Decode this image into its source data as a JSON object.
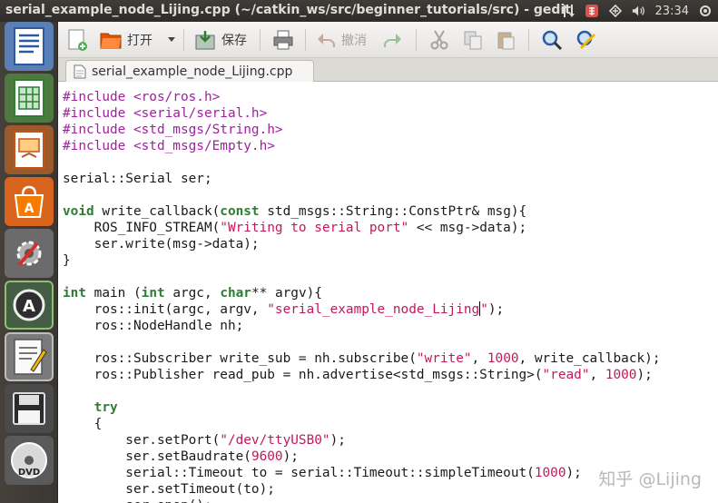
{
  "window_title": "serial_example_node_Lijing.cpp (~/catkin_ws/src/beginner_tutorials/src) - gedit",
  "tray": {
    "clock": "23:34",
    "icons": [
      "sort-arrows-icon",
      "keyboard-input-icon",
      "network-icon",
      "volume-icon"
    ]
  },
  "launcher": {
    "items": [
      "writer-icon",
      "calc-icon",
      "impress-icon",
      "software-center-icon",
      "system-settings-icon",
      "update-manager-icon",
      "text-editor-icon",
      "floppy-save-icon",
      "dvd-icon"
    ]
  },
  "toolbar": {
    "open_label": "打开",
    "save_label": "保存",
    "undo_label": "撤消"
  },
  "tab": {
    "label": "serial_example_node_Lijing.cpp"
  },
  "code_lines": [
    [
      {
        "t": "#include <ros/ros.h>",
        "c": "pp"
      }
    ],
    [
      {
        "t": "#include <serial/serial.h>",
        "c": "pp"
      }
    ],
    [
      {
        "t": "#include <std_msgs/String.h>",
        "c": "pp"
      }
    ],
    [
      {
        "t": "#include <std_msgs/Empty.h>",
        "c": "pp"
      }
    ],
    [],
    [
      {
        "t": "serial::Serial ser;"
      }
    ],
    [],
    [
      {
        "t": "void",
        "c": "kw"
      },
      {
        "t": " write_callback("
      },
      {
        "t": "const",
        "c": "kw"
      },
      {
        "t": " std_msgs::String::ConstPtr& msg){"
      }
    ],
    [
      {
        "t": "    ROS_INFO_STREAM("
      },
      {
        "t": "\"Writing to serial port\"",
        "c": "st"
      },
      {
        "t": " << msg->data);"
      }
    ],
    [
      {
        "t": "    ser.write(msg->data);"
      }
    ],
    [
      {
        "t": "}"
      }
    ],
    [],
    [
      {
        "t": "int",
        "c": "kw"
      },
      {
        "t": " main ("
      },
      {
        "t": "int",
        "c": "kw"
      },
      {
        "t": " argc, "
      },
      {
        "t": "char",
        "c": "kw"
      },
      {
        "t": "** argv){"
      }
    ],
    [
      {
        "t": "    ros::init(argc, argv, "
      },
      {
        "t": "\"serial_example_node_Lijing",
        "c": "st"
      },
      {
        "t": "",
        "c": "caret"
      },
      {
        "t": "\"",
        "c": "st"
      },
      {
        "t": ");"
      }
    ],
    [
      {
        "t": "    ros::NodeHandle nh;"
      }
    ],
    [],
    [
      {
        "t": "    ros::Subscriber write_sub = nh.subscribe("
      },
      {
        "t": "\"write\"",
        "c": "st"
      },
      {
        "t": ", "
      },
      {
        "t": "1000",
        "c": "nm"
      },
      {
        "t": ", write_callback);"
      }
    ],
    [
      {
        "t": "    ros::Publisher read_pub = nh.advertise<std_msgs::String>("
      },
      {
        "t": "\"read\"",
        "c": "st"
      },
      {
        "t": ", "
      },
      {
        "t": "1000",
        "c": "nm"
      },
      {
        "t": ");"
      }
    ],
    [],
    [
      {
        "t": "    "
      },
      {
        "t": "try",
        "c": "kw"
      }
    ],
    [
      {
        "t": "    {"
      }
    ],
    [
      {
        "t": "        ser.setPort("
      },
      {
        "t": "\"/dev/ttyUSB0\"",
        "c": "st"
      },
      {
        "t": ");"
      }
    ],
    [
      {
        "t": "        ser.setBaudrate("
      },
      {
        "t": "9600",
        "c": "nm"
      },
      {
        "t": ");"
      }
    ],
    [
      {
        "t": "        serial::Timeout to = serial::Timeout::simpleTimeout("
      },
      {
        "t": "1000",
        "c": "nm"
      },
      {
        "t": ");"
      }
    ],
    [
      {
        "t": "        ser.setTimeout(to);"
      }
    ],
    [
      {
        "t": "        ser.open();"
      }
    ]
  ],
  "watermark": "知乎 @Lijing"
}
